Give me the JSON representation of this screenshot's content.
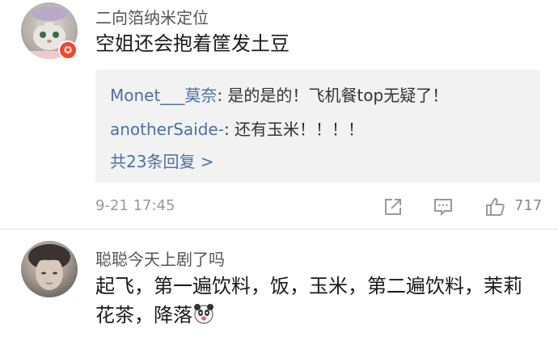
{
  "comments": [
    {
      "username": "二向箔纳米定位",
      "text": "空姐还会抱着筐发土豆",
      "badge_icon": "verified-badge-icon",
      "replies": [
        {
          "user": "Monet___莫奈",
          "text": ": 是的是的！飞机餐top无疑了！"
        },
        {
          "user": "anotherSaide-",
          "text": ": 还有玉米！！！！"
        }
      ],
      "more_replies": "共23条回复 >",
      "timestamp": "9-21 17:45",
      "like_count": "717"
    },
    {
      "username": "聪聪今天上剧了吗",
      "text_line1": "起飞，第一遍饮料，饭，玉米，第二遍饮料，茉莉",
      "text_line2": "花茶，降落"
    }
  ],
  "icons": {
    "share": "share-icon",
    "comment": "comment-icon",
    "like": "thumbs-up-icon",
    "emoji": "panda-emoji-icon"
  },
  "colors": {
    "link_blue": "#4d6fa0",
    "badge_red": "#f2472f",
    "reply_bg": "#f2f2f2"
  }
}
